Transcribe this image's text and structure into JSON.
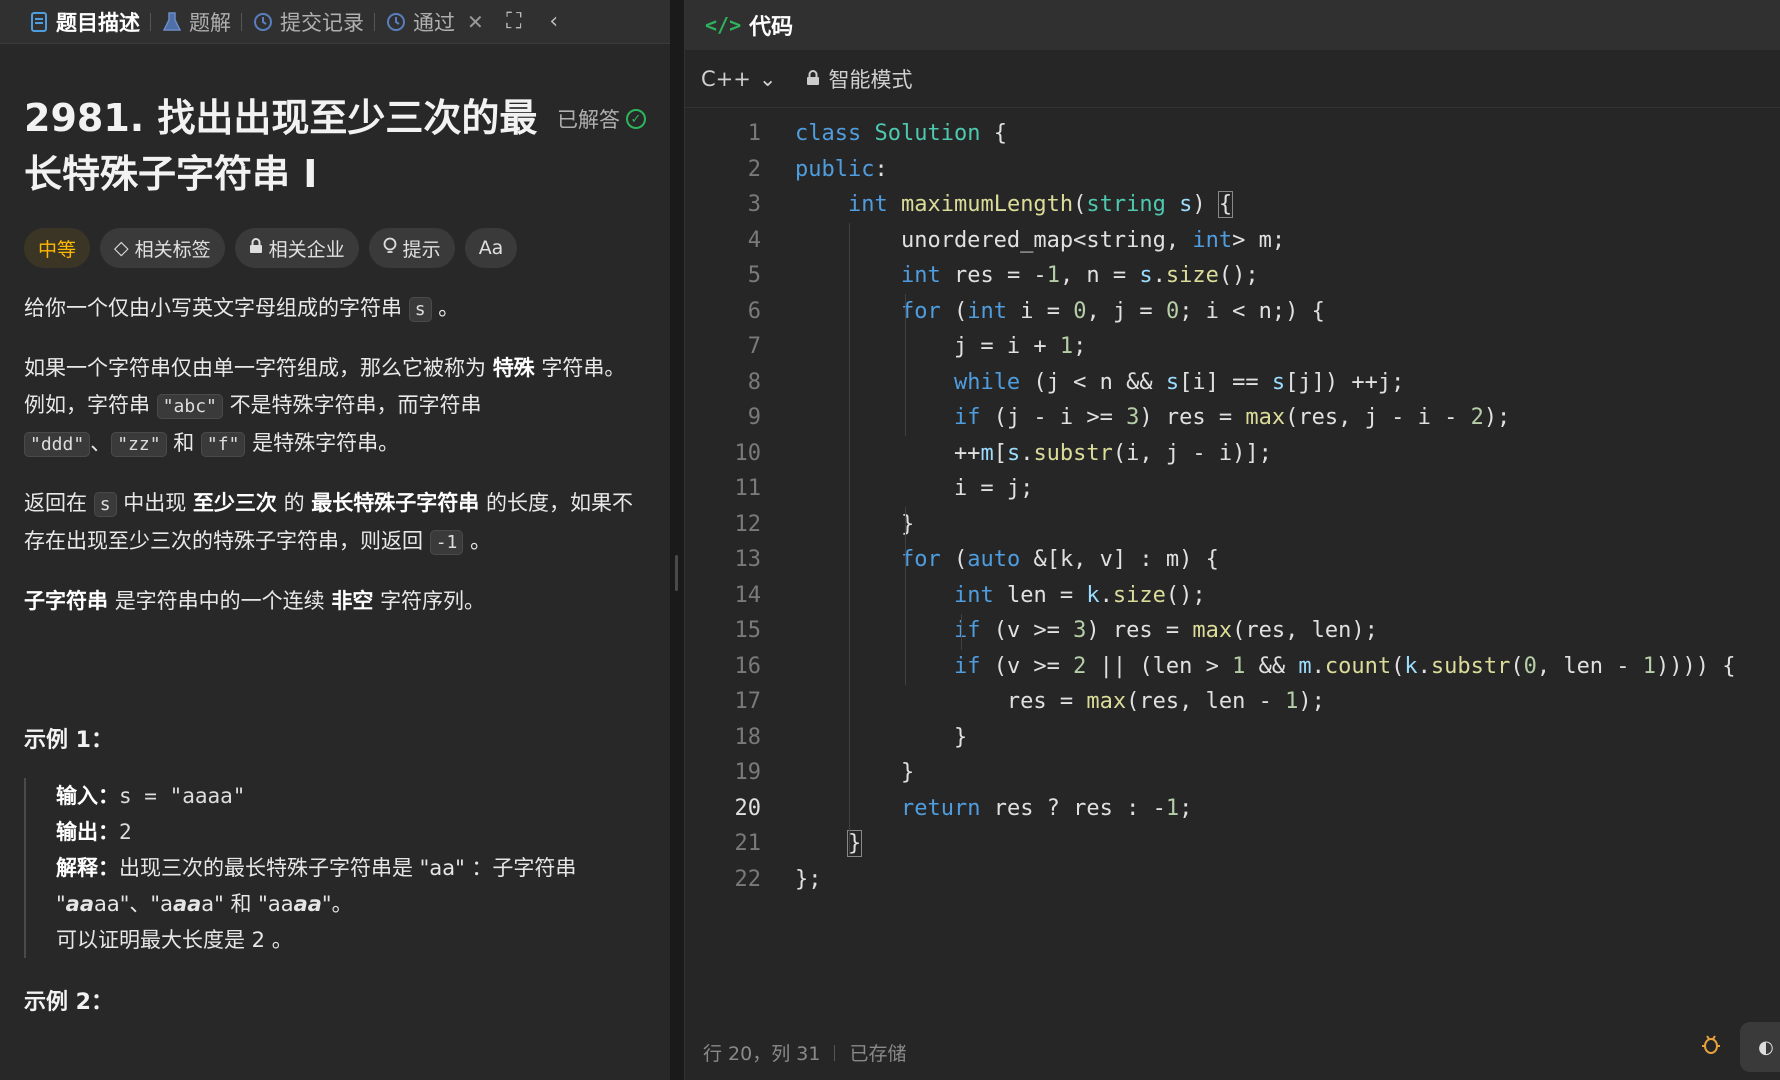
{
  "left_tabs": {
    "description": "题目描述",
    "solution": "题解",
    "submissions": "提交记录",
    "accepted": "通过"
  },
  "problem": {
    "title": "2981. 找出出现至少三次的最长特殊子字符串 I",
    "status": "已解答",
    "tags": {
      "difficulty": "中等",
      "related_tags": "相关标签",
      "companies": "相关企业",
      "hint": "提示",
      "font": "Aa"
    },
    "p1_pre": "给你一个仅由小写英文字母组成的字符串",
    "p1_code": "s",
    "p1_post": "。",
    "p2_a": "如果一个字符串仅由单一字符组成，那么它被称为",
    "p2_b": "特殊",
    "p2_c": "字符串。例如，字符串",
    "p2_code1": "\"abc\"",
    "p2_d": "不是特殊字符串，而字符串",
    "p2_code2": "\"ddd\"",
    "p2_e": "、",
    "p2_code3": "\"zz\"",
    "p2_f": "和",
    "p2_code4": "\"f\"",
    "p2_g": "是特殊字符串。",
    "p3_a": "返回在",
    "p3_code1": "s",
    "p3_b": "中出现",
    "p3_c": "至少三次",
    "p3_d": "的",
    "p3_e": "最长特殊子字符串",
    "p3_f": "的长度，如果不存在出现至少三次的特殊子字符串，则返回",
    "p3_code2": "-1",
    "p3_g": "。",
    "p4_a": "子字符串",
    "p4_b": "是字符串中的一个连续",
    "p4_c": "非空",
    "p4_d": "字符序列。",
    "example1_title": "示例 1：",
    "ex_input_label": "输入：",
    "ex_input_value": "s = \"aaaa\"",
    "ex_output_label": "输出：",
    "ex_output_value": "2",
    "ex_explain_label": "解释：",
    "ex_explain_1": "出现三次的最长特殊子字符串是 \"aa\" ：子字符串 \"",
    "ex_explain_2": "aa",
    "ex_explain_3": "aa\"、\"a",
    "ex_explain_4": "aa",
    "ex_explain_5": "a\" 和 \"aa",
    "ex_explain_6": "aa",
    "ex_explain_7": "\"。",
    "ex_explain_last": "可以证明最大长度是 2 。",
    "example2_title": "示例 2："
  },
  "editor": {
    "panel_title": "代码",
    "language": "C++",
    "mode": "智能模式",
    "cursor_status": "行 20，列 31",
    "save_status": "已存储",
    "current_line": 20
  },
  "colors": {
    "keyword": "#4f9dde",
    "type": "#4ec9b0",
    "function": "#dcdc9a",
    "number": "#b5cea8",
    "difficulty": "#ffb800",
    "accent": "#2db55d"
  }
}
